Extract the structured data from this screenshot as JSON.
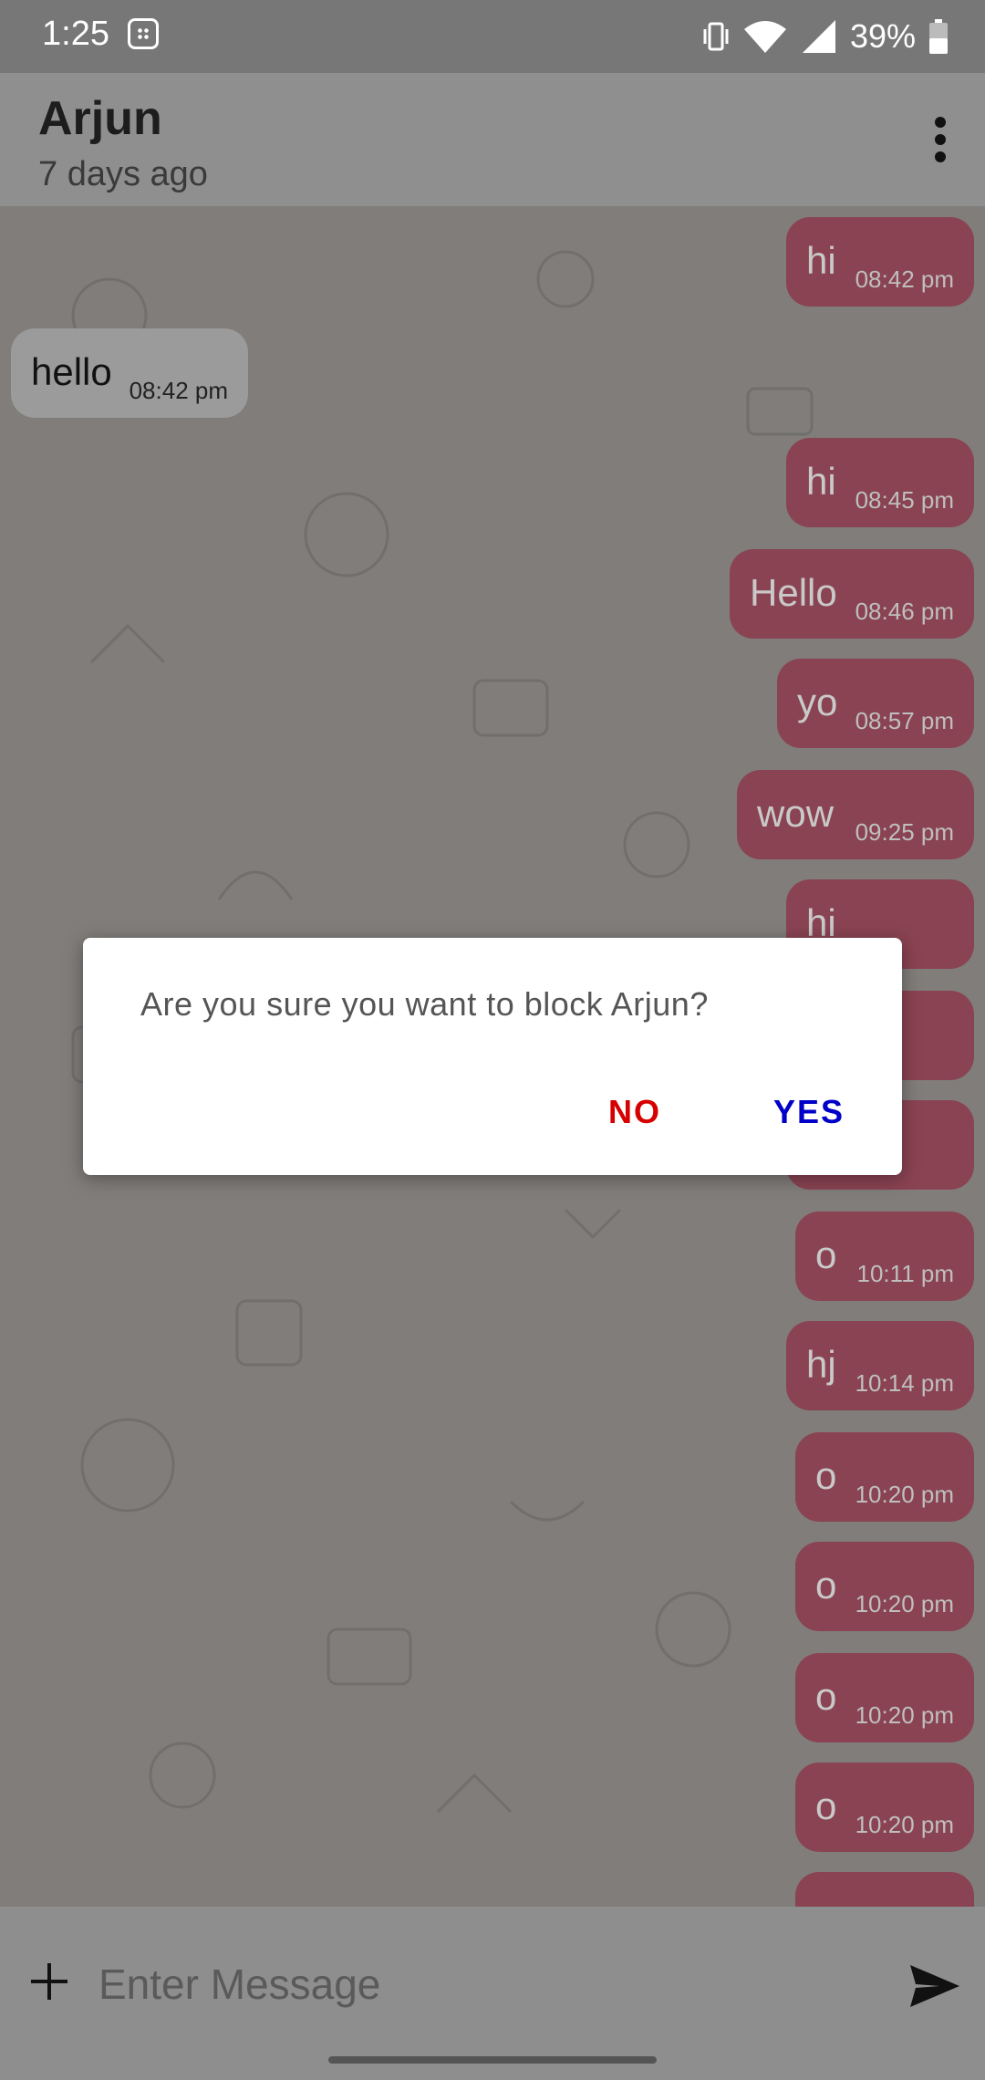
{
  "status_bar": {
    "time": "1:25",
    "battery": "39%",
    "icons": [
      "app-icon",
      "vibrate-icon",
      "wifi-icon",
      "signal-icon",
      "battery-icon"
    ]
  },
  "header": {
    "name": "Arjun",
    "last_seen": "7 days ago",
    "menu_icon": "more-vert-icon"
  },
  "messages": [
    {
      "text": "hi",
      "time": "08:42 pm",
      "direction": "out"
    },
    {
      "text": "hello",
      "time": "08:42 pm",
      "direction": "in"
    },
    {
      "text": "hi",
      "time": "08:45 pm",
      "direction": "out"
    },
    {
      "text": "Hello",
      "time": "08:46 pm",
      "direction": "out"
    },
    {
      "text": "yo",
      "time": "08:57 pm",
      "direction": "out"
    },
    {
      "text": "wow",
      "time": "09:25 pm",
      "direction": "out"
    },
    {
      "text": "hi",
      "time": "",
      "direction": "out"
    },
    {
      "text": "",
      "time": "",
      "direction": "out"
    },
    {
      "text": "",
      "time": "",
      "direction": "out"
    },
    {
      "text": "o",
      "time": "10:11 pm",
      "direction": "out"
    },
    {
      "text": "hj",
      "time": "10:14 pm",
      "direction": "out"
    },
    {
      "text": "o",
      "time": "10:20 pm",
      "direction": "out"
    },
    {
      "text": "o",
      "time": "10:20 pm",
      "direction": "out"
    },
    {
      "text": "o",
      "time": "10:20 pm",
      "direction": "out"
    },
    {
      "text": "o",
      "time": "10:20 pm",
      "direction": "out"
    }
  ],
  "dialog": {
    "message": "Are you sure you want to block Arjun?",
    "no_label": "NO",
    "yes_label": "YES"
  },
  "composer": {
    "placeholder": "Enter Message",
    "attach_icon": "plus-icon",
    "send_icon": "send-icon"
  },
  "colors": {
    "outgoing_bubble": "#8a4352",
    "incoming_bubble": "#9b9b9b",
    "dialog_no": "#d60000",
    "dialog_yes": "#0000c8"
  }
}
